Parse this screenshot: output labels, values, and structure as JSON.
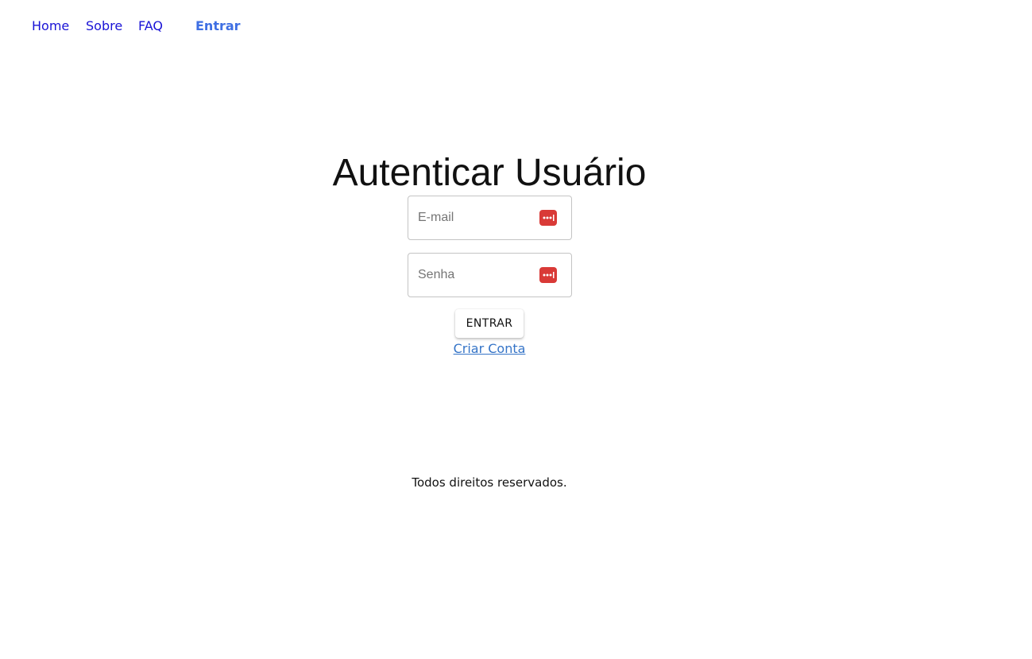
{
  "nav": {
    "items": [
      {
        "label": "Home"
      },
      {
        "label": "Sobre"
      },
      {
        "label": "FAQ"
      },
      {
        "label": "Entrar",
        "active": true
      }
    ]
  },
  "login": {
    "title": "Autenticar Usuário",
    "email_placeholder": "E-mail",
    "email_value": "",
    "password_placeholder": "Senha",
    "password_value": "",
    "field_icon": "password-manager-icon",
    "submit_label": "ENTRAR",
    "create_account_label": "Criar Conta"
  },
  "footer": {
    "text": "Todos direitos reservados."
  },
  "colors": {
    "nav_link": "#1a13d6",
    "nav_active": "#3f6fe3",
    "link": "#3574c7",
    "icon_red": "#d93a37"
  }
}
